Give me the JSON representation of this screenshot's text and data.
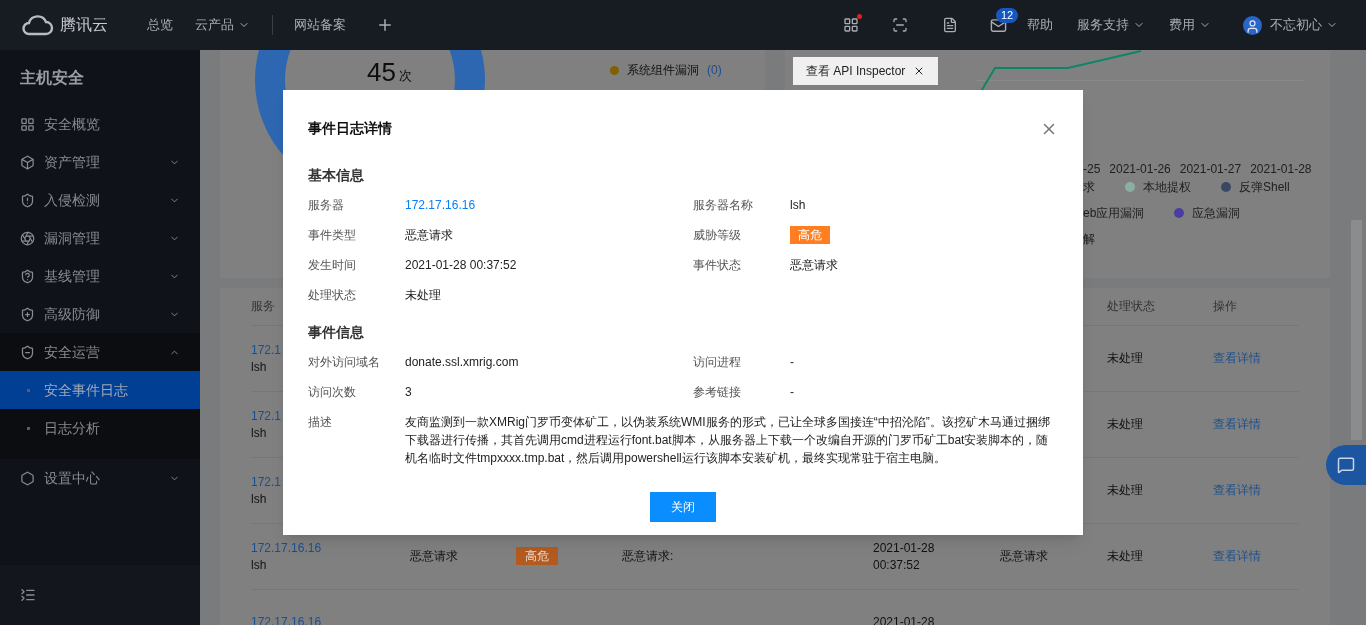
{
  "header": {
    "logo": "腾讯云",
    "nav": [
      {
        "label": "总览",
        "dropdown": false
      },
      {
        "label": "云产品",
        "dropdown": true
      },
      {
        "label": "网站备案",
        "dropdown": false
      }
    ],
    "mail_badge": "12",
    "links": [
      {
        "label": "帮助",
        "dropdown": false
      },
      {
        "label": "服务支持",
        "dropdown": true
      },
      {
        "label": "费用",
        "dropdown": true
      }
    ],
    "user": "不忘初心"
  },
  "sidebar": {
    "title": "主机安全",
    "items": [
      {
        "label": "安全概览",
        "kind": "link"
      },
      {
        "label": "资产管理",
        "kind": "group",
        "expanded": false
      },
      {
        "label": "入侵检测",
        "kind": "group",
        "expanded": false
      },
      {
        "label": "漏洞管理",
        "kind": "group",
        "expanded": false
      },
      {
        "label": "基线管理",
        "kind": "group",
        "expanded": false
      },
      {
        "label": "高级防御",
        "kind": "group",
        "expanded": false
      },
      {
        "label": "安全运营",
        "kind": "group",
        "expanded": true,
        "children": [
          {
            "label": "安全事件日志",
            "selected": true
          },
          {
            "label": "日志分析",
            "selected": false
          }
        ]
      },
      {
        "label": "设置中心",
        "kind": "group",
        "expanded": false
      }
    ]
  },
  "overview_card": {
    "count": "45",
    "unit": "次",
    "legend": [
      {
        "label": "系统组件漏洞",
        "count": "(0)",
        "color": "#806000"
      }
    ]
  },
  "trend_card": {
    "dates": [
      "-25",
      "2021-01-26",
      "2021-01-27",
      "2021-01-28"
    ],
    "legend_rows": [
      [
        {
          "label": "求"
        },
        {
          "label": "本地提权",
          "color": "#8ab0a6"
        },
        {
          "label": "反弹Shell",
          "color": "#3a4760"
        }
      ],
      [
        {
          "label": "eb应用漏洞"
        },
        {
          "label": "应急漏洞",
          "color": "#4a3da0"
        }
      ],
      [
        {
          "label": "解"
        }
      ]
    ]
  },
  "tooltip": {
    "label": "查看 API Inspector"
  },
  "table": {
    "columns": {
      "server": "服务",
      "handle": "处理状态",
      "action": "操作"
    },
    "rows": [
      {
        "server": "172.1",
        "name": "lsh",
        "handle": "未处理",
        "action": "查看详情"
      },
      {
        "server": "172.1",
        "name": "lsh",
        "handle": "未处理",
        "action": "查看详情"
      },
      {
        "server": "172.1",
        "name": "lsh",
        "handle": "未处理",
        "action": "查看详情"
      },
      {
        "server": "172.17.16.16",
        "name": "lsh",
        "type": "恶意请求",
        "level": "高危",
        "desc": "恶意请求:",
        "date": "2021-01-28",
        "time": "00:37:52",
        "status": "恶意请求",
        "handle": "未处理",
        "action": "查看详情"
      },
      {
        "server": "172.17.16.16",
        "date": "2021-01-28"
      }
    ]
  },
  "dialog": {
    "title": "事件日志详情",
    "sections": [
      {
        "title": "基本信息",
        "fields": [
          {
            "label": "服务器",
            "value": "172.17.16.16",
            "kind": "link"
          },
          {
            "label": "服务器名称",
            "value": "lsh",
            "kind": "text"
          },
          {
            "label": "事件类型",
            "value": "恶意请求",
            "kind": "text"
          },
          {
            "label": "威胁等级",
            "value": "高危",
            "kind": "badge"
          },
          {
            "label": "发生时间",
            "value": "2021-01-28 00:37:52",
            "kind": "text"
          },
          {
            "label": "事件状态",
            "value": "恶意请求",
            "kind": "text"
          },
          {
            "label": "处理状态",
            "value": "未处理",
            "kind": "text"
          }
        ]
      },
      {
        "title": "事件信息",
        "fields": [
          {
            "label": "对外访问域名",
            "value": "donate.ssl.xmrig.com",
            "kind": "text"
          },
          {
            "label": "访问进程",
            "value": "-",
            "kind": "text"
          },
          {
            "label": "访问次数",
            "value": "3",
            "kind": "text"
          },
          {
            "label": "参考链接",
            "value": "-",
            "kind": "text"
          },
          {
            "label": "描述",
            "value": "友商监测到一款XMRig门罗币变体矿工，以伪装系统WMI服务的形式，已让全球多国接连“中招沦陷”。该挖矿木马通过捆绑下载器进行传播，其首先调用cmd进程运行font.bat脚本，从服务器上下载一个改编自开源的门罗币矿工bat安装脚本的，随机名临时文件tmpxxxx.tmp.bat，然后调用powershell运行该脚本安装矿机，最终实现常驻于宿主电脑。",
            "kind": "wide"
          }
        ]
      }
    ],
    "button": "关闭"
  }
}
